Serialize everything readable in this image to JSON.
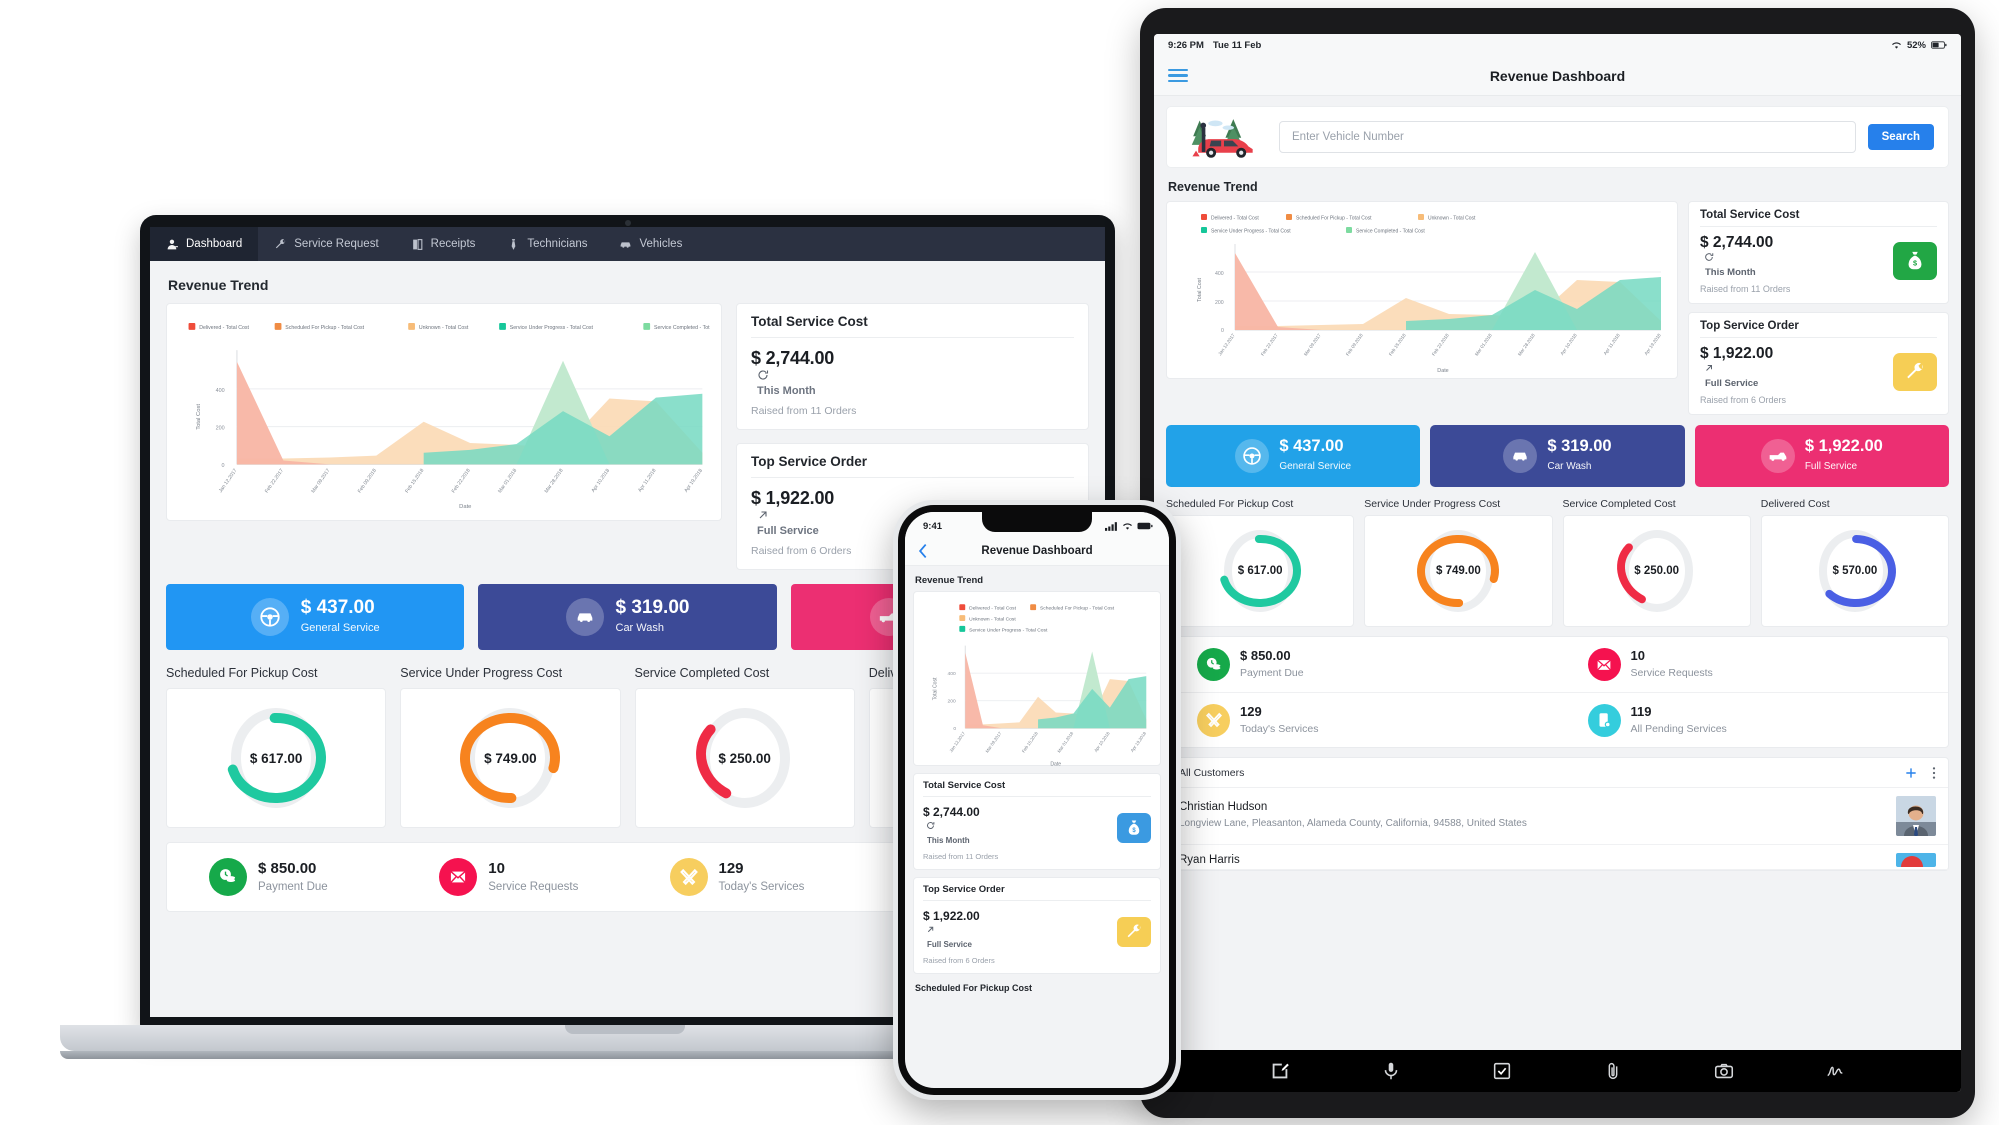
{
  "laptop": {
    "nav": [
      {
        "label": "Dashboard",
        "icon": "user-icon",
        "active": true
      },
      {
        "label": "Service Request",
        "icon": "wrench-icon",
        "active": false
      },
      {
        "label": "Receipts",
        "icon": "receipt-icon",
        "active": false
      },
      {
        "label": "Technicians",
        "icon": "tie-icon",
        "active": false
      },
      {
        "label": "Vehicles",
        "icon": "car-icon",
        "active": false
      }
    ],
    "section_title": "Revenue Trend",
    "kpis": [
      {
        "title": "Total Service Cost",
        "amount": "$ 2,744.00",
        "sub": "This Month",
        "note": "Raised from 11 Orders",
        "icon": "money-bag-icon",
        "icon_color": "#27ae43"
      },
      {
        "title": "Top Service Order",
        "amount": "$ 1,922.00",
        "sub": "Full Service",
        "note": "Raised from 6 Orders",
        "icon": "wrench-icon",
        "icon_color": "#f6ce55"
      }
    ],
    "tiles": [
      {
        "amount": "$ 437.00",
        "label": "General Service",
        "color": "#2196f3",
        "icon": "steering-wheel-icon"
      },
      {
        "amount": "$ 319.00",
        "label": "Car Wash",
        "color": "#3c4a97",
        "icon": "car-front-icon"
      },
      {
        "amount": "$ 1,922.00",
        "label": "Full Service",
        "color": "#ec2f72",
        "icon": "truck-icon"
      }
    ],
    "donuts": [
      {
        "label": "Scheduled For Pickup Cost",
        "value": "$ 617.00",
        "color": "#1fc9a0",
        "pct": 72
      },
      {
        "label": "Service Under Progress Cost",
        "value": "$ 749.00",
        "color": "#f7831e",
        "pct": 80
      },
      {
        "label": "Service Completed Cost",
        "value": "$ 250.00",
        "color": "#ef2b45",
        "pct": 28
      },
      {
        "label": "Delivered Cost",
        "value": "$ 570.00",
        "color": "#4a5fe4",
        "pct": 62
      }
    ],
    "stats": [
      {
        "num": "$ 850.00",
        "label": "Payment Due",
        "color": "#16a94a",
        "icon": "coins-icon"
      },
      {
        "num": "10",
        "label": "Service Requests",
        "color": "#f5124f",
        "icon": "envelope-icon"
      },
      {
        "num": "129",
        "label": "Today's Services",
        "color": "#f7ce5f",
        "icon": "tools-icon"
      },
      {
        "num": "119",
        "label": "All Pending Services",
        "color": "#34cddd",
        "icon": "mobile-settings-icon"
      }
    ]
  },
  "tablet": {
    "status": {
      "time": "9:26 PM",
      "date": "Tue 11 Feb",
      "battery": "52%",
      "wifi": "wifi-icon"
    },
    "app_title": "Revenue Dashboard",
    "search": {
      "placeholder": "Enter Vehicle Number",
      "value": "",
      "button": "Search",
      "illustration": "car-scene-illustration"
    },
    "section_title": "Revenue Trend",
    "kpis": [
      {
        "title": "Total Service Cost",
        "amount": "$ 2,744.00",
        "sub": "This Month",
        "note": "Raised from 11 Orders",
        "icon": "money-bag-icon",
        "icon_color": "#22a745"
      },
      {
        "title": "Top Service Order",
        "amount": "$ 1,922.00",
        "sub": "Full Service",
        "note": "Raised from 6 Orders",
        "icon": "wrench-icon",
        "icon_color": "#f6ce55"
      }
    ],
    "tiles": [
      {
        "amount": "$ 437.00",
        "label": "General Service",
        "color": "#22a2e8",
        "icon": "steering-wheel-icon"
      },
      {
        "amount": "$ 319.00",
        "label": "Car Wash",
        "color": "#3c4a97",
        "icon": "car-front-icon"
      },
      {
        "amount": "$ 1,922.00",
        "label": "Full Service",
        "color": "#ec2f72",
        "icon": "truck-icon"
      }
    ],
    "donuts": [
      {
        "label": "Scheduled For Pickup Cost",
        "value": "$ 617.00",
        "color": "#1fc9a0",
        "pct": 72
      },
      {
        "label": "Service Under Progress Cost",
        "value": "$ 749.00",
        "color": "#f7831e",
        "pct": 80
      },
      {
        "label": "Service Completed Cost",
        "value": "$ 250.00",
        "color": "#ef2b45",
        "pct": 28
      },
      {
        "label": "Delivered Cost",
        "value": "$ 570.00",
        "color": "#4a5fe4",
        "pct": 62
      }
    ],
    "stats": [
      {
        "num": "$ 850.00",
        "label": "Payment Due",
        "color": "#16a94a",
        "icon": "coins-icon"
      },
      {
        "num": "10",
        "label": "Service Requests",
        "color": "#f5124f",
        "icon": "envelope-icon"
      },
      {
        "num": "129",
        "label": "Today's Services",
        "color": "#f7ce5f",
        "icon": "tools-icon"
      },
      {
        "num": "119",
        "label": "All Pending Services",
        "color": "#34cddd",
        "icon": "mobile-settings-icon"
      }
    ],
    "customers": {
      "title": "All Customers",
      "add_icon": "plus-icon",
      "more_icon": "kebab-menu-icon",
      "rows": [
        {
          "name": "Christian Hudson",
          "address": "Longview Lane, Pleasanton, Alameda County, California, 94588, United States"
        },
        {
          "name": "Ryan Harris",
          "address": ""
        }
      ]
    },
    "toolbar": [
      "edit-icon",
      "mic-icon",
      "checkbox-icon",
      "paperclip-icon",
      "camera-icon",
      "signature-icon"
    ]
  },
  "phone": {
    "status": {
      "time": "9:41",
      "signal": "cellular-icon",
      "wifi": "wifi-icon",
      "battery": "battery-icon"
    },
    "back_icon": "chevron-left-icon",
    "app_title": "Revenue Dashboard",
    "section_title": "Revenue Trend",
    "kpis": [
      {
        "title": "Total Service Cost",
        "amount": "$ 2,744.00",
        "sub": "This Month",
        "note": "Raised from 11 Orders",
        "icon": "money-bag-icon",
        "icon_color": "#3b9ae1"
      },
      {
        "title": "Top Service Order",
        "amount": "$ 1,922.00",
        "sub": "Full Service",
        "note": "Raised from 6 Orders",
        "icon": "wrench-icon",
        "icon_color": "#f6ce55"
      }
    ],
    "footer_label": "Scheduled For Pickup Cost"
  },
  "chart_data": {
    "type": "area",
    "title": "Revenue Trend",
    "xlabel": "Date",
    "ylabel": "Total Cost",
    "ylim": [
      0,
      600
    ],
    "yticks": [
      0,
      200,
      400
    ],
    "grid": true,
    "legend_position": "top",
    "categories": [
      "Jan 12,2017",
      "Feb 22,2017",
      "Mar 09,2017",
      "Feb 09,2018",
      "Feb 15,2018",
      "Feb 22,2018",
      "Mar 01,2018",
      "Mar 28,2018",
      "Apr 10,2018",
      "Apr 11,2018",
      "Apr 19,2018"
    ],
    "series": [
      {
        "name": "Delivered - Total Cost",
        "color": "#ef4c3a",
        "values": [
          540,
          20,
          0,
          0,
          0,
          0,
          0,
          0,
          0,
          0,
          0
        ]
      },
      {
        "name": "Scheduled For Pickup - Total Cost",
        "color": "#f08c44",
        "values": [
          0,
          0,
          0,
          0,
          0,
          0,
          0,
          0,
          0,
          0,
          0
        ]
      },
      {
        "name": "Unknown - Total Cost",
        "color": "#f7bc78",
        "values": [
          30,
          30,
          35,
          45,
          225,
          110,
          100,
          85,
          345,
          330,
          60
        ]
      },
      {
        "name": "Service Under Progress - Total Cost",
        "color": "#16c79a",
        "values": [
          0,
          0,
          0,
          0,
          60,
          75,
          105,
          280,
          150,
          350,
          370
        ]
      },
      {
        "name": "Service Completed - Total Cost",
        "color": "#7ddba0",
        "values": [
          0,
          0,
          0,
          0,
          0,
          0,
          0,
          545,
          0,
          0,
          0
        ]
      }
    ]
  }
}
